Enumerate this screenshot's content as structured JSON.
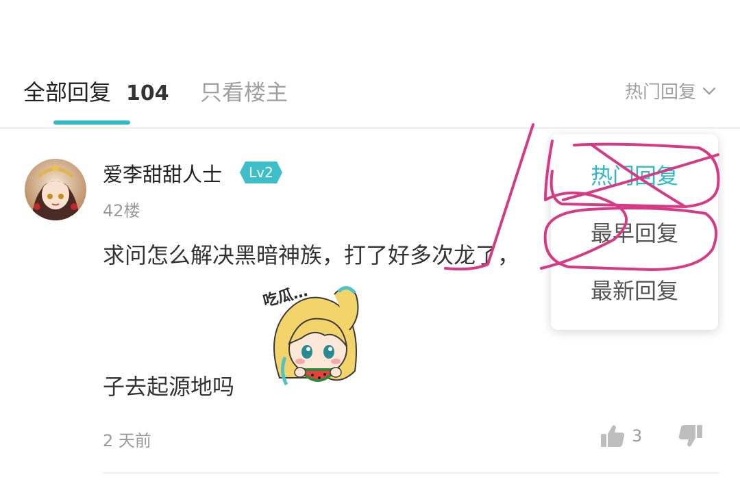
{
  "tabs": {
    "all_label": "全部回复",
    "all_count": "104",
    "owner_only_label": "只看楼主"
  },
  "sort": {
    "selected": "热门回复",
    "options": [
      "热门回复",
      "最早回复",
      "最新回复"
    ],
    "accent_color": "#2fbac7"
  },
  "reply": {
    "username": "爱李甜甜人士",
    "level": "Lv2",
    "floor": "42楼",
    "content_line1": "求问怎么解决黑暗神族，打了好多次龙了，",
    "content_line2": "子去起源地吗",
    "time": "2 天前",
    "likes": "3"
  },
  "colors": {
    "accent": "#2fbac7",
    "annotation": "#d63a85"
  }
}
